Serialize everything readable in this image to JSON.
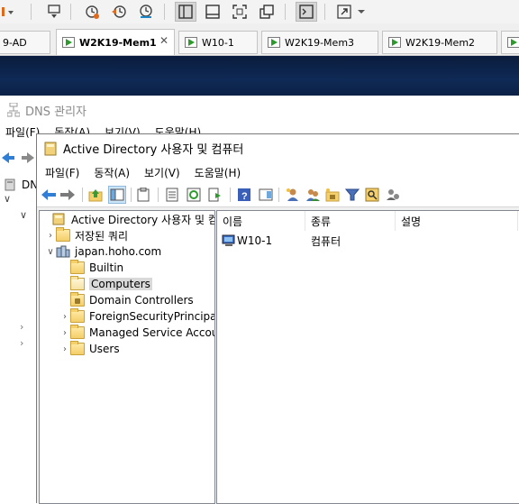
{
  "vm": {
    "toolbar": {
      "icons": [
        "dropdown-caret-icon",
        "send-ctrl-alt-del-icon",
        "snapshot-take-icon",
        "snapshot-revert-icon",
        "snapshot-manager-icon",
        "view-library-icon",
        "view-thumbnail-icon",
        "fit-guest-icon",
        "unity-icon",
        "console-icon",
        "fullscreen-icon",
        "fullscreen-dropdown-icon"
      ]
    },
    "tabs": [
      {
        "label": "9-AD",
        "active": false
      },
      {
        "label": "W2K19-Mem1",
        "active": true
      },
      {
        "label": "W10-1",
        "active": false
      },
      {
        "label": "W2K19-Mem3",
        "active": false
      },
      {
        "label": "W2K19-Mem2",
        "active": false
      }
    ]
  },
  "dns": {
    "title": "DNS 관리자",
    "menu": [
      "파일(F)",
      "동작(A)",
      "보기(V)",
      "도움말(H)"
    ],
    "tree_label": "DNS"
  },
  "aduc": {
    "title": "Active Directory 사용자 및 컴퓨터",
    "menu": [
      "파일(F)",
      "동작(A)",
      "보기(V)",
      "도움말(H)"
    ],
    "tree": {
      "root": "Active Directory 사용자 및 컴퓨터",
      "saved_queries": "저장된 쿼리",
      "domain": "japan.hoho.com",
      "children": [
        "Builtin",
        "Computers",
        "Domain Controllers",
        "ForeignSecurityPrincipal",
        "Managed Service Accou",
        "Users"
      ],
      "selected": "Computers"
    },
    "list": {
      "columns": [
        "이름",
        "종류",
        "설명"
      ],
      "rows": [
        {
          "name": "W10-1",
          "type": "컴퓨터",
          "description": ""
        }
      ]
    }
  }
}
